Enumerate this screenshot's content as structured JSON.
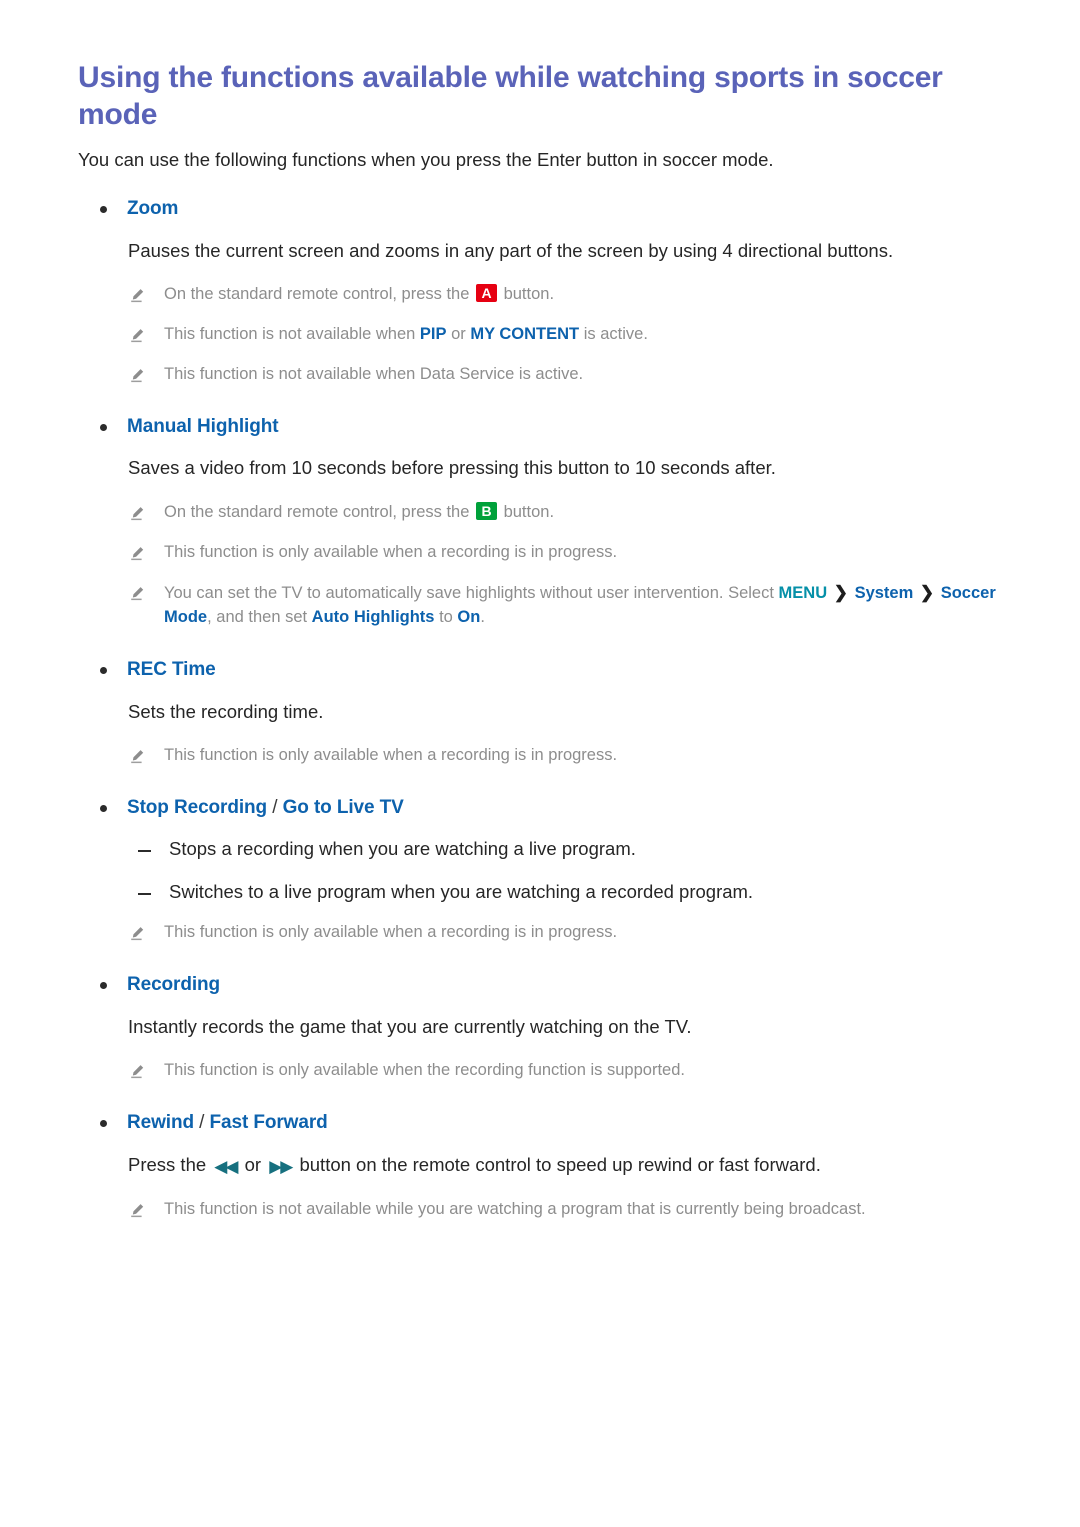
{
  "document": {
    "title": "Using the functions available while watching sports in soccer mode",
    "intro": "You can use the following functions when you press the Enter button in soccer mode.",
    "separator": " / "
  },
  "colors": {
    "title": "#5a63b8",
    "heading_link": "#0d62ad",
    "note_text": "#8d8d8d",
    "body_text": "#262626",
    "key_a_bg": "#e60012",
    "key_b_bg": "#00a13a",
    "transport_icon": "#17707f",
    "menu_teal": "#0590a8"
  },
  "icons": {
    "pencil": "pencil-note-icon",
    "bullet": "bullet-dot-icon",
    "dash": "dash-mark-icon",
    "rewind": "rewind-icon",
    "fast_forward": "fast-forward-icon",
    "chevron": "chevron-right-icon"
  },
  "sections": {
    "zoom": {
      "label": "Zoom",
      "body": "Pauses the current screen and zooms in any part of the screen by using 4 directional buttons.",
      "note1_pre": "On the standard remote control, press the ",
      "note1_key": "A",
      "note1_post": " button.",
      "note2_pre": "This function is not available when ",
      "note2_term1": "PIP",
      "note2_mid": " or ",
      "note2_term2": "MY CONTENT",
      "note2_post": " is active.",
      "note3": "This function is not available when Data Service is active."
    },
    "manual_highlight": {
      "label": "Manual Highlight",
      "body": "Saves a video from 10 seconds before pressing this button to 10 seconds after.",
      "note1_pre": "On the standard remote control, press the ",
      "note1_key": "B",
      "note1_post": " button.",
      "note2": "This function is only available when a recording is in progress.",
      "note3_pre": "You can set the TV to automatically save highlights without user intervention. Select ",
      "note3_menu": "MENU",
      "note3_chevron": "❯",
      "note3_system": "System",
      "note3_soccer": "Soccer Mode",
      "note3_mid": ", and then set ",
      "note3_auto": "Auto Highlights",
      "note3_to": " to ",
      "note3_on": "On",
      "note3_end": "."
    },
    "rec_time": {
      "label": "REC Time",
      "body": "Sets the recording time.",
      "note1": "This function is only available when a recording is in progress."
    },
    "stop_recording": {
      "label_a": "Stop Recording",
      "label_b": "Go to Live TV",
      "dash1": "Stops a recording when you are watching a live program.",
      "dash2": "Switches to a live program when you are watching a recorded program.",
      "note1": "This function is only available when a recording is in progress."
    },
    "recording": {
      "label": "Recording",
      "body": "Instantly records the game that you are currently watching on the TV.",
      "note1": "This function is only available when the recording function is supported."
    },
    "rewind_fast_forward": {
      "label_a": "Rewind",
      "label_b": "Fast Forward",
      "body_pre": "Press the ",
      "body_rewind_glyph": "◀◀",
      "body_mid": " or ",
      "body_forward_glyph": "▶▶",
      "body_post": " button on the remote control to speed up rewind or fast forward.",
      "note1": "This function is not available while you are watching a program that is currently being broadcast."
    }
  }
}
